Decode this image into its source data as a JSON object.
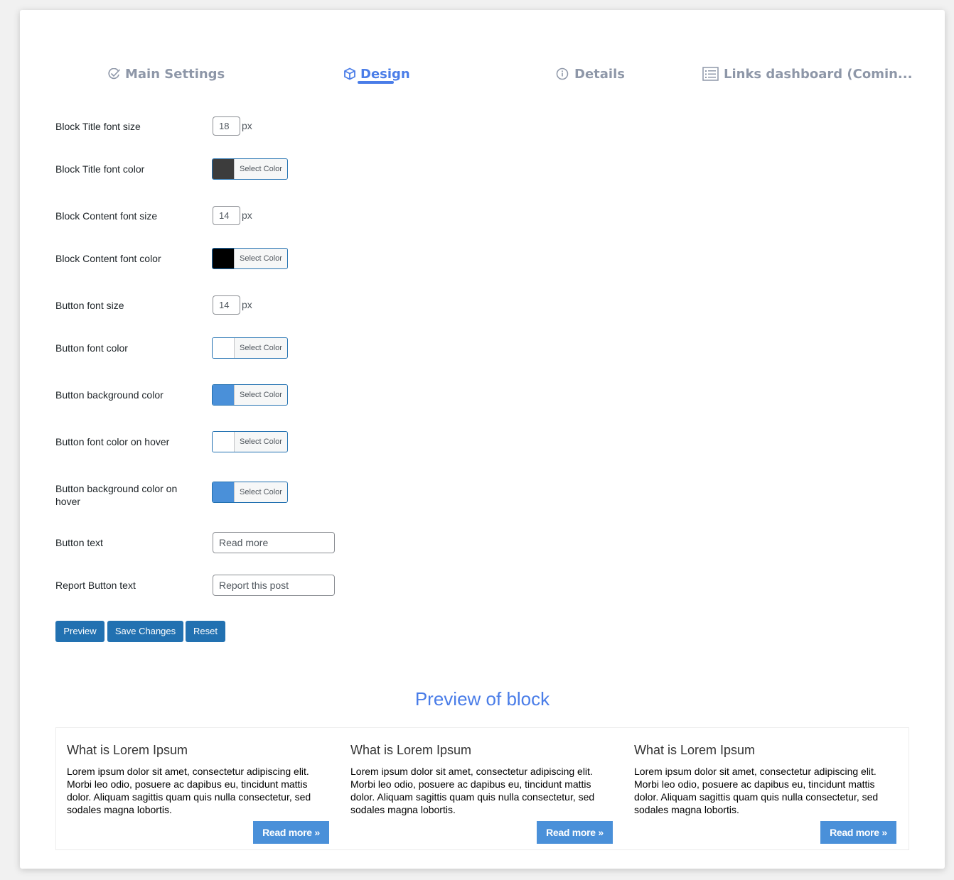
{
  "tabs": [
    {
      "label": "Main Settings",
      "icon": "check-circle-icon",
      "active": false
    },
    {
      "label": "Design",
      "icon": "cube-icon",
      "active": true
    },
    {
      "label": "Details",
      "icon": "info-icon",
      "active": false
    },
    {
      "label": "Links dashboard (Comin...",
      "icon": "list-icon",
      "active": false
    }
  ],
  "form": {
    "block_title_font_size": {
      "label": "Block Title font size",
      "value": "18",
      "unit": "px"
    },
    "block_title_font_color": {
      "label": "Block Title font color",
      "button": "Select Color",
      "color": "#3c3c3c"
    },
    "block_content_font_size": {
      "label": "Block Content font size",
      "value": "14",
      "unit": "px"
    },
    "block_content_font_color": {
      "label": "Block Content font color",
      "button": "Select Color",
      "color": "#000000"
    },
    "button_font_size": {
      "label": "Button font size",
      "value": "14",
      "unit": "px"
    },
    "button_font_color": {
      "label": "Button font color",
      "button": "Select Color",
      "color": "#ffffff"
    },
    "button_background_color": {
      "label": "Button background color",
      "button": "Select Color",
      "color": "#4a90d9"
    },
    "button_font_color_hover": {
      "label": "Button font color on hover",
      "button": "Select Color",
      "color": "#ffffff"
    },
    "button_background_color_hover": {
      "label": "Button background color on hover",
      "button": "Select Color",
      "color": "#4a90d9"
    },
    "button_text": {
      "label": "Button text",
      "value": "Read more"
    },
    "report_button_text": {
      "label": "Report Button text",
      "value": "Report this post"
    }
  },
  "actions": {
    "preview": "Preview",
    "save": "Save Changes",
    "reset": "Reset"
  },
  "preview": {
    "heading": "Preview of block",
    "blocks": [
      {
        "title": "What is Lorem Ipsum",
        "content": "Lorem ipsum dolor sit amet, consectetur adipiscing elit. Morbi leo odio, posuere ac dapibus eu, tincidunt mattis dolor. Aliquam sagittis quam quis nulla consectetur, sed sodales magna lobortis.",
        "button": "Read more »"
      },
      {
        "title": "What is Lorem Ipsum",
        "content": "Lorem ipsum dolor sit amet, consectetur adipiscing elit. Morbi leo odio, posuere ac dapibus eu, tincidunt mattis dolor. Aliquam sagittis quam quis nulla consectetur, sed sodales magna lobortis.",
        "button": "Read more »"
      },
      {
        "title": "What is Lorem Ipsum",
        "content": "Lorem ipsum dolor sit amet, consectetur adipiscing elit. Morbi leo odio, posuere ac dapibus eu, tincidunt mattis dolor. Aliquam sagittis quam quis nulla consectetur, sed sodales magna lobortis.",
        "button": "Read more »"
      }
    ]
  },
  "colors": {
    "accent": "#4a7de8",
    "wp_button": "#2271b1",
    "tab_inactive": "#8e97a8"
  }
}
